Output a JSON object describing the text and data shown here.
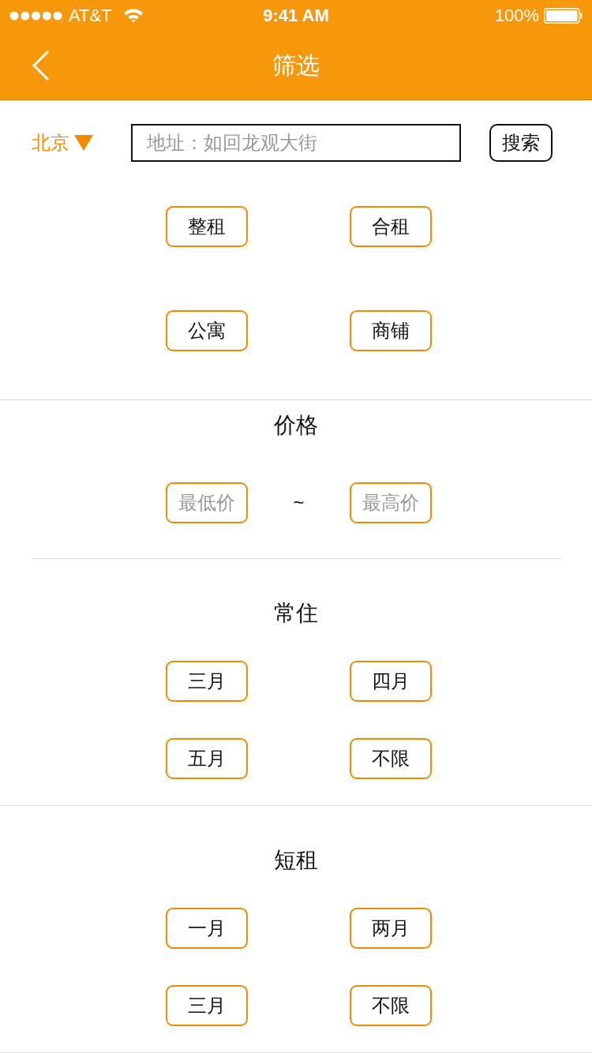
{
  "status_bar": {
    "carrier": "AT&T",
    "time": "9:41 AM",
    "battery": "100%"
  },
  "nav_bar": {
    "title": "筛选"
  },
  "search": {
    "city": "北京",
    "placeholder": "地址：如回龙观大街",
    "button": "搜索"
  },
  "house_types": [
    {
      "label": "整租",
      "selected": false
    },
    {
      "label": "合租",
      "selected": false
    },
    {
      "label": "公寓",
      "selected": false
    },
    {
      "label": "商铺",
      "selected": false
    }
  ],
  "price": {
    "title": "价格",
    "min_placeholder": "最低价",
    "separator": "~",
    "max_placeholder": "最高价"
  },
  "long_stay": {
    "title": "常住",
    "options": [
      {
        "label": "三月",
        "selected": false
      },
      {
        "label": "四月",
        "selected": false
      },
      {
        "label": "五月",
        "selected": false
      },
      {
        "label": "不限",
        "selected": false
      }
    ]
  },
  "short_stay": {
    "title": "短租",
    "options": [
      {
        "label": "一月",
        "selected": false
      },
      {
        "label": "两月",
        "selected": false
      },
      {
        "label": "三月",
        "selected": false
      },
      {
        "label": "不限",
        "selected": false
      }
    ]
  }
}
